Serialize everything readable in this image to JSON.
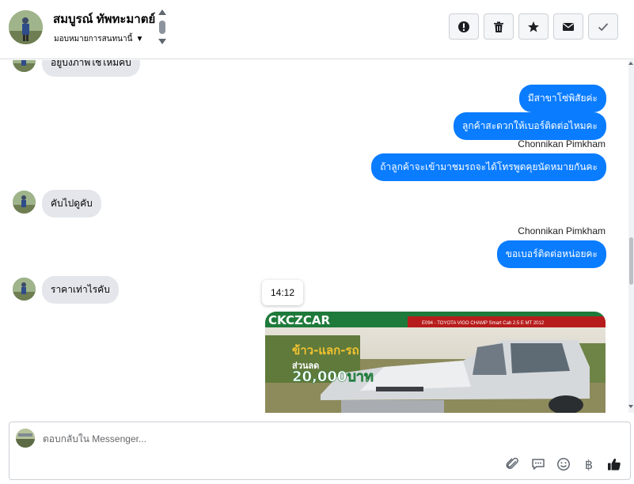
{
  "header": {
    "contact_name": "สมบูรณ์ ทัพทะมาตย์",
    "assign_label": "มอบหมายการสนทนานี้",
    "actions": [
      {
        "name": "mark-spam-button",
        "icon": "alert-icon"
      },
      {
        "name": "delete-button",
        "icon": "trash-icon"
      },
      {
        "name": "star-button",
        "icon": "star-icon"
      },
      {
        "name": "mark-unread-button",
        "icon": "envelope-icon"
      },
      {
        "name": "mark-done-button",
        "icon": "check-icon"
      }
    ]
  },
  "messages": {
    "in_top": "อยู่บ้งภาพใช้ไหมคับ",
    "out_1": "มีสาขาโซ่พิสัยค่ะ",
    "out_2": "ลูกค้าสะดวกให้เบอร์ติดต่อไหมคะ",
    "sender_1": "Chonnikan Pimkham",
    "out_3": "ถ้าลูกค้าจะเข้ามาชมรถจะได้โทรพูดคุยนัดหมายกันคะ",
    "in_2": "คับไปดูคับ",
    "sender_2": "Chonnikan Pimkham",
    "out_4": "ขอเบอร์ติดต่อหน่อยคะ",
    "in_3": "ราคาเท่าไรคับ",
    "timestamp": "14:12",
    "image": {
      "banner_text": "CKCZCAR",
      "model_text": "E094 - TOYOTA VIGO CHAMP Smart Cab 2.5 E MT 2012",
      "promo_top": "ข้าว-แลก-รถ",
      "promo_mid": "ส่วนลด",
      "promo_amount": "20,000บาท"
    }
  },
  "composer": {
    "placeholder": "ตอบกลับใน Messenger..."
  },
  "colors": {
    "accent": "#0a7cff",
    "bubble_in": "#e4e6eb"
  }
}
